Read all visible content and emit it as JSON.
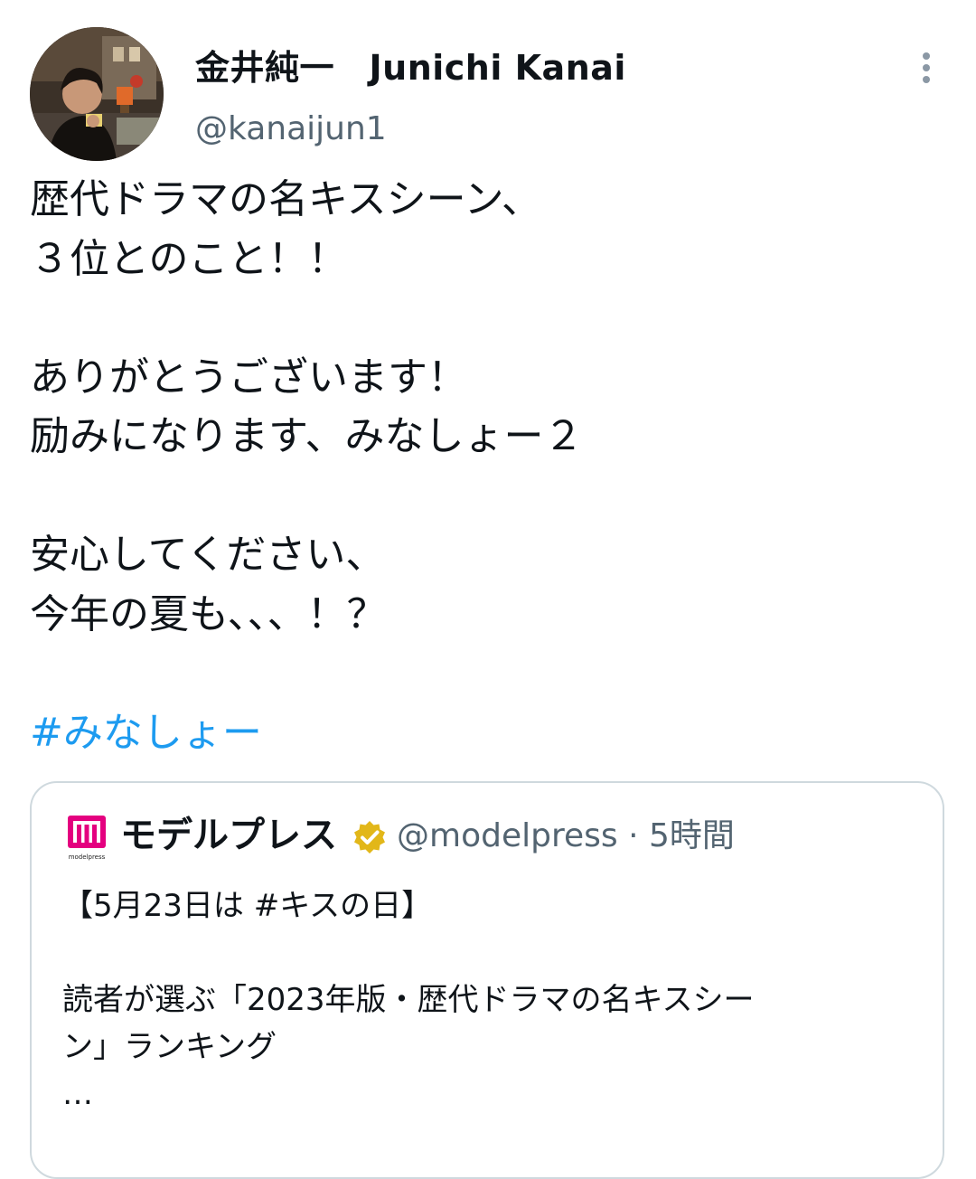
{
  "author": {
    "display_name": "金井純一　Junichi Kanai",
    "handle": "@kanaijun1",
    "avatar_icon": "profile-photo"
  },
  "more_icon": "more-vertical-icon",
  "tweet": {
    "lines": [
      "歴代ドラマの名キスシーン、",
      "３位とのこと！！",
      "",
      "ありがとうございます！",
      "励みになります、みなしょー２",
      "",
      "安心してください、",
      "今年の夏も、、、！？",
      ""
    ],
    "hashtag": "#みなしょー"
  },
  "quoted_tweet": {
    "logo_icon": "modelpress-logo",
    "logo_text": "modelpress",
    "name": "モデルプレス",
    "verified_icon": "verified-badge-gold",
    "handle": "@modelpress",
    "separator": "·",
    "time": "5時間",
    "lines": [
      "【5月23日は #キスの日】",
      "",
      "読者が選ぶ「2023年版・歴代ドラマの名キスシー",
      "ン」ランキング",
      "…"
    ]
  },
  "colors": {
    "text": "#0f1419",
    "secondary": "#536471",
    "link": "#1d9bf0",
    "border": "#cfd9de",
    "verified_gold": "#e2b719",
    "logo_magenta": "#e4007f"
  }
}
